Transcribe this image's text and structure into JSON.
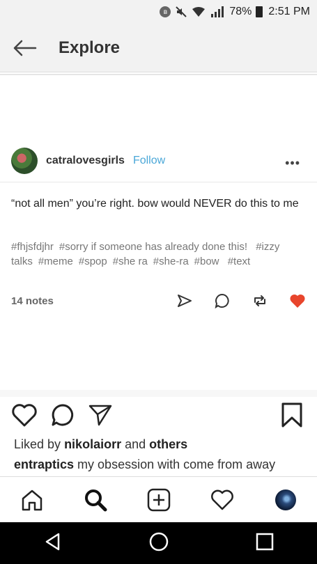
{
  "status_bar": {
    "battery": "78%",
    "time": "2:51 PM"
  },
  "header": {
    "title": "Explore",
    "back_icon": "arrow-left-icon"
  },
  "post": {
    "username": "catralovesgirls",
    "follow_label": "Follow",
    "more_label": "•••",
    "body": "“not all men” you’re right. bow would NEVER do this to me",
    "tags": [
      "#fhjsfdjhr",
      "#sorry if someone has already done this!",
      "#izzy talks",
      "#meme",
      "#spop",
      "#she ra",
      "#she-ra",
      "#bow",
      "#text"
    ],
    "notes": "14 notes",
    "actions": [
      "share-icon",
      "reply-icon",
      "reblog-icon",
      "heart-filled-icon"
    ],
    "like_color": "#e8452c"
  },
  "instagram": {
    "actions": [
      "heart-outline-icon",
      "comment-icon",
      "send-icon",
      "bookmark-icon"
    ],
    "liked_prefix": "Liked by",
    "liked_user": "nikolaiorr",
    "liked_and": "and",
    "liked_others": "others",
    "caption_user": "entraptics",
    "caption_text": "my obsession with come from away"
  },
  "tabbar": {
    "tabs": [
      "home-icon",
      "search-icon",
      "add-icon",
      "heart-icon",
      "profile-avatar"
    ]
  },
  "navbar": {
    "buttons": [
      "back-triangle-icon",
      "home-circle-icon",
      "recents-square-icon"
    ]
  },
  "colors": {
    "follow": "#4aa7d8",
    "tag": "#777777",
    "header_bg": "#f2f2f2",
    "navbar_bg": "#000000"
  }
}
